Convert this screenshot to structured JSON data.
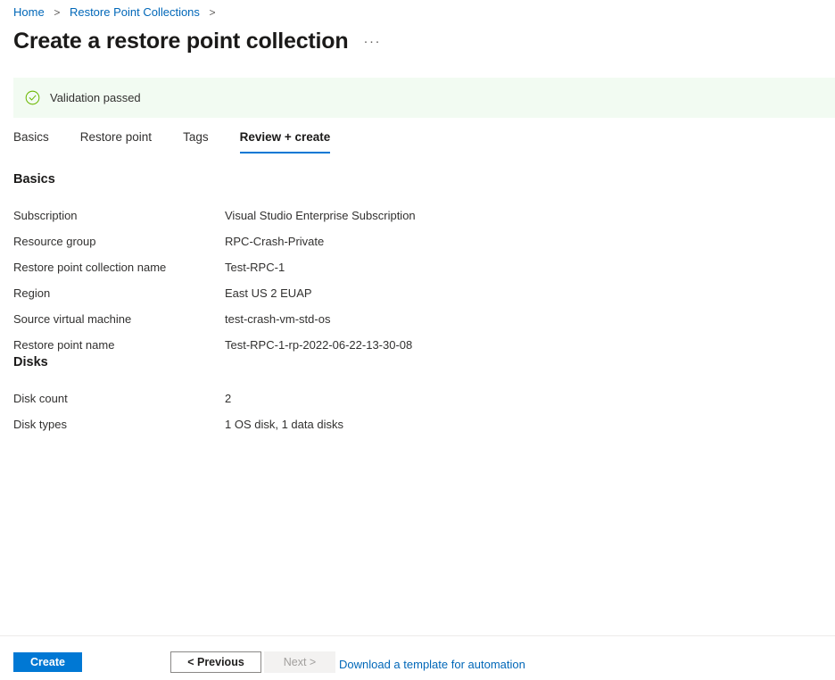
{
  "breadcrumb": {
    "items": [
      {
        "label": "Home"
      },
      {
        "label": "Restore Point Collections"
      }
    ],
    "separator": ">"
  },
  "header": {
    "title": "Create a restore point collection",
    "more_menu": "···"
  },
  "validation": {
    "message": "Validation passed",
    "icon": "check-circle-icon",
    "background_color": "#f2fbf2",
    "icon_color": "#57a300"
  },
  "tabs": [
    {
      "label": "Basics",
      "active": false
    },
    {
      "label": "Restore point",
      "active": false
    },
    {
      "label": "Tags",
      "active": false
    },
    {
      "label": "Review + create",
      "active": true
    }
  ],
  "sections": [
    {
      "heading": "Basics",
      "rows": [
        {
          "label": "Subscription",
          "value": "Visual Studio Enterprise Subscription"
        },
        {
          "label": "Resource group",
          "value": "RPC-Crash-Private"
        },
        {
          "label": "Restore point collection name",
          "value": "Test-RPC-1"
        },
        {
          "label": "Region",
          "value": "East US 2 EUAP"
        },
        {
          "label": "Source virtual machine",
          "value": "test-crash-vm-std-os"
        },
        {
          "label": "Restore point name",
          "value": "Test-RPC-1-rp-2022-06-22-13-30-08"
        }
      ]
    },
    {
      "heading": "Disks",
      "rows": [
        {
          "label": "Disk count",
          "value": "2"
        },
        {
          "label": "Disk types",
          "value": "1 OS disk, 1 data disks"
        }
      ]
    }
  ],
  "footer": {
    "create_label": "Create",
    "previous_label": "< Previous",
    "next_label": "Next >",
    "download_template_label": "Download a template for automation",
    "accent_color": "#0078d4",
    "link_color": "#0067b8"
  }
}
